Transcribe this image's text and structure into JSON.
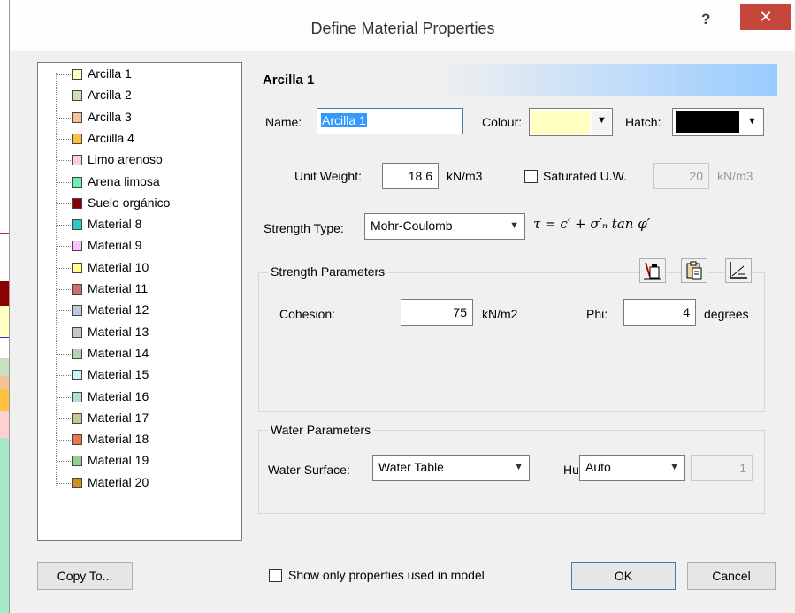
{
  "dialog": {
    "title": "Define Material Properties",
    "help_glyph": "?",
    "close_glyph": "✕"
  },
  "materials": [
    {
      "label": "Arcilla 1",
      "color": "#ffffc0"
    },
    {
      "label": "Arcilla 2",
      "color": "#c8e0c0"
    },
    {
      "label": "Arcilla 3",
      "color": "#f4c498"
    },
    {
      "label": "Arciilla 4",
      "color": "#ffc040"
    },
    {
      "label": "Limo arenoso",
      "color": "#ffd0d0"
    },
    {
      "label": "Arena limosa",
      "color": "#70f0b0"
    },
    {
      "label": "Suelo orgánico",
      "color": "#8b0000"
    },
    {
      "label": "Material 8",
      "color": "#30c8c8"
    },
    {
      "label": "Material 9",
      "color": "#ffc0ff"
    },
    {
      "label": "Material 10",
      "color": "#ffff90"
    },
    {
      "label": "Material 11",
      "color": "#d07068"
    },
    {
      "label": "Material 12",
      "color": "#c0c8e0"
    },
    {
      "label": "Material 13",
      "color": "#c8c8c8"
    },
    {
      "label": "Material 14",
      "color": "#b8d0b8"
    },
    {
      "label": "Material 15",
      "color": "#c0f8f8"
    },
    {
      "label": "Material 16",
      "color": "#b0e0d8"
    },
    {
      "label": "Material 17",
      "color": "#c8c890"
    },
    {
      "label": "Material 18",
      "color": "#f07848"
    },
    {
      "label": "Material 19",
      "color": "#90d090"
    },
    {
      "label": "Material 20",
      "color": "#d09020"
    }
  ],
  "header": {
    "material_name": "Arcilla 1"
  },
  "name_field": {
    "label": "Name:",
    "value": "Arcilla 1"
  },
  "colour": {
    "label": "Colour:",
    "value": "#ffffc0"
  },
  "hatch": {
    "label": "Hatch:",
    "value": "#000000"
  },
  "unit_weight": {
    "label": "Unit Weight:",
    "value": "18.6",
    "unit": "kN/m3"
  },
  "saturated": {
    "label": "Saturated U.W.",
    "value": "20",
    "unit": "kN/m3"
  },
  "strength_type": {
    "label": "Strength Type:",
    "value": "Mohr-Coulomb",
    "formula": "τ = c′ + σ′ₙ tan φ′"
  },
  "strength_params": {
    "title": "Strength Parameters",
    "cohesion_label": "Cohesion:",
    "cohesion_value": "75",
    "cohesion_unit": "kN/m2",
    "phi_label": "Phi:",
    "phi_value": "4",
    "phi_unit": "degrees"
  },
  "water_params": {
    "title": "Water Parameters",
    "surface_label": "Water Surface:",
    "surface_value": "Water Table",
    "hu_label": "Hu:",
    "hu_value": "Auto",
    "hu_number": "1"
  },
  "footer": {
    "copy_label": "Copy To...",
    "show_only_label": "Show only properties used in model",
    "ok_label": "OK",
    "cancel_label": "Cancel"
  },
  "icons": [
    "flask-import-icon",
    "clipboard-paste-icon",
    "chart-edit-icon",
    "chevron-down-icon"
  ]
}
